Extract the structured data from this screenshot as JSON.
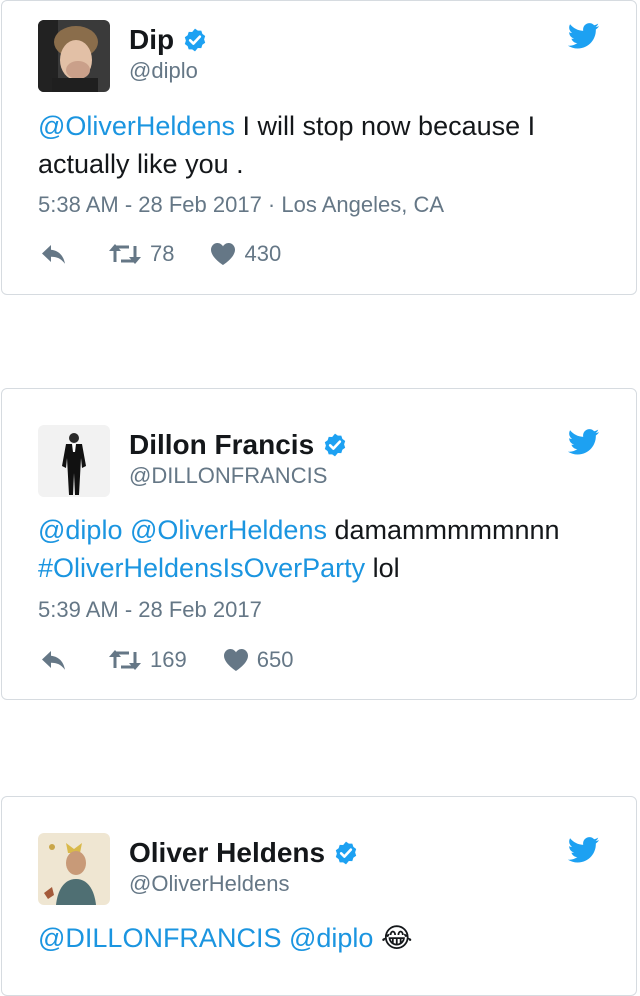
{
  "tweets": [
    {
      "name": "Dip",
      "handle": "@diplo",
      "text_link1": "@OliverHeldens",
      "text_rest": " I will stop now because I actually like you .",
      "meta": "5:38 AM - 28 Feb 2017 · Los Angeles, CA",
      "retweets": "78",
      "likes": "430"
    },
    {
      "name": "Dillon Francis",
      "handle": "@DILLONFRANCIS",
      "text_link1": "@diplo",
      "text_link2": "@OliverHeldens",
      "text_mid": " damammmmmnnn",
      "text_link3": "#OliverHeldensIsOverParty",
      "text_end": " lol",
      "meta": "5:39 AM - 28 Feb 2017",
      "retweets": "169",
      "likes": "650"
    },
    {
      "name": "Oliver Heldens",
      "handle": "@OliverHeldens",
      "text_link1": "@DILLONFRANCIS",
      "text_link2": "@diplo",
      "emoji": "😂"
    }
  ],
  "colors": {
    "link": "#1b95e0",
    "muted": "#657786",
    "verified": "#1da1f2",
    "border": "#d6dbe0"
  },
  "icons": [
    "verified-badge-icon",
    "twitter-bird-icon",
    "reply-icon",
    "retweet-icon",
    "heart-icon"
  ]
}
